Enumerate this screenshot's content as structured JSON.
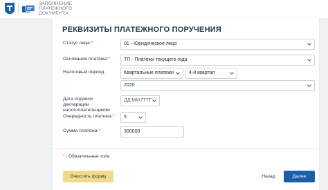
{
  "header": {
    "service_title": "ЗАПОЛНЕНИЕ ПЛАТЕЖНОГО ДОКУМЕНТА",
    "logo_icon": "fns-emblem-icon",
    "service_icon": "payment-document-icon"
  },
  "form": {
    "title": "РЕКВИЗИТЫ ПЛАТЕЖНОГО ПОРУЧЕНИЯ",
    "payer_status": {
      "label": "Статус лица:",
      "value": "01 - Юридическое лицо"
    },
    "payment_basis": {
      "label": "Основание платежа:",
      "value": "ТП - Платежи текущего года"
    },
    "tax_period": {
      "label": "Налоговый период",
      "period_type": "Квартальные платежи",
      "period": "4-й квартал",
      "year": "2020"
    },
    "declaration_date": {
      "label": "Дата подписи декларации налогоплательщиком",
      "placeholder": "ДД.ММ.ГГГГ"
    },
    "payment_priority": {
      "label": "Очередность платежа:",
      "value": "5"
    },
    "payment_amount": {
      "label": "Сумма платежа:",
      "value": "300000"
    },
    "required_mark": "*",
    "required_note": "- Обязательные поля."
  },
  "buttons": {
    "clear": "Очистить форму",
    "back": "Назад",
    "next": "Далее"
  },
  "colors": {
    "page_background": "#eef1f4",
    "accent_blue": "#1b5fa8",
    "clear_button": "#f3d98a",
    "required_red": "#d0342c"
  }
}
